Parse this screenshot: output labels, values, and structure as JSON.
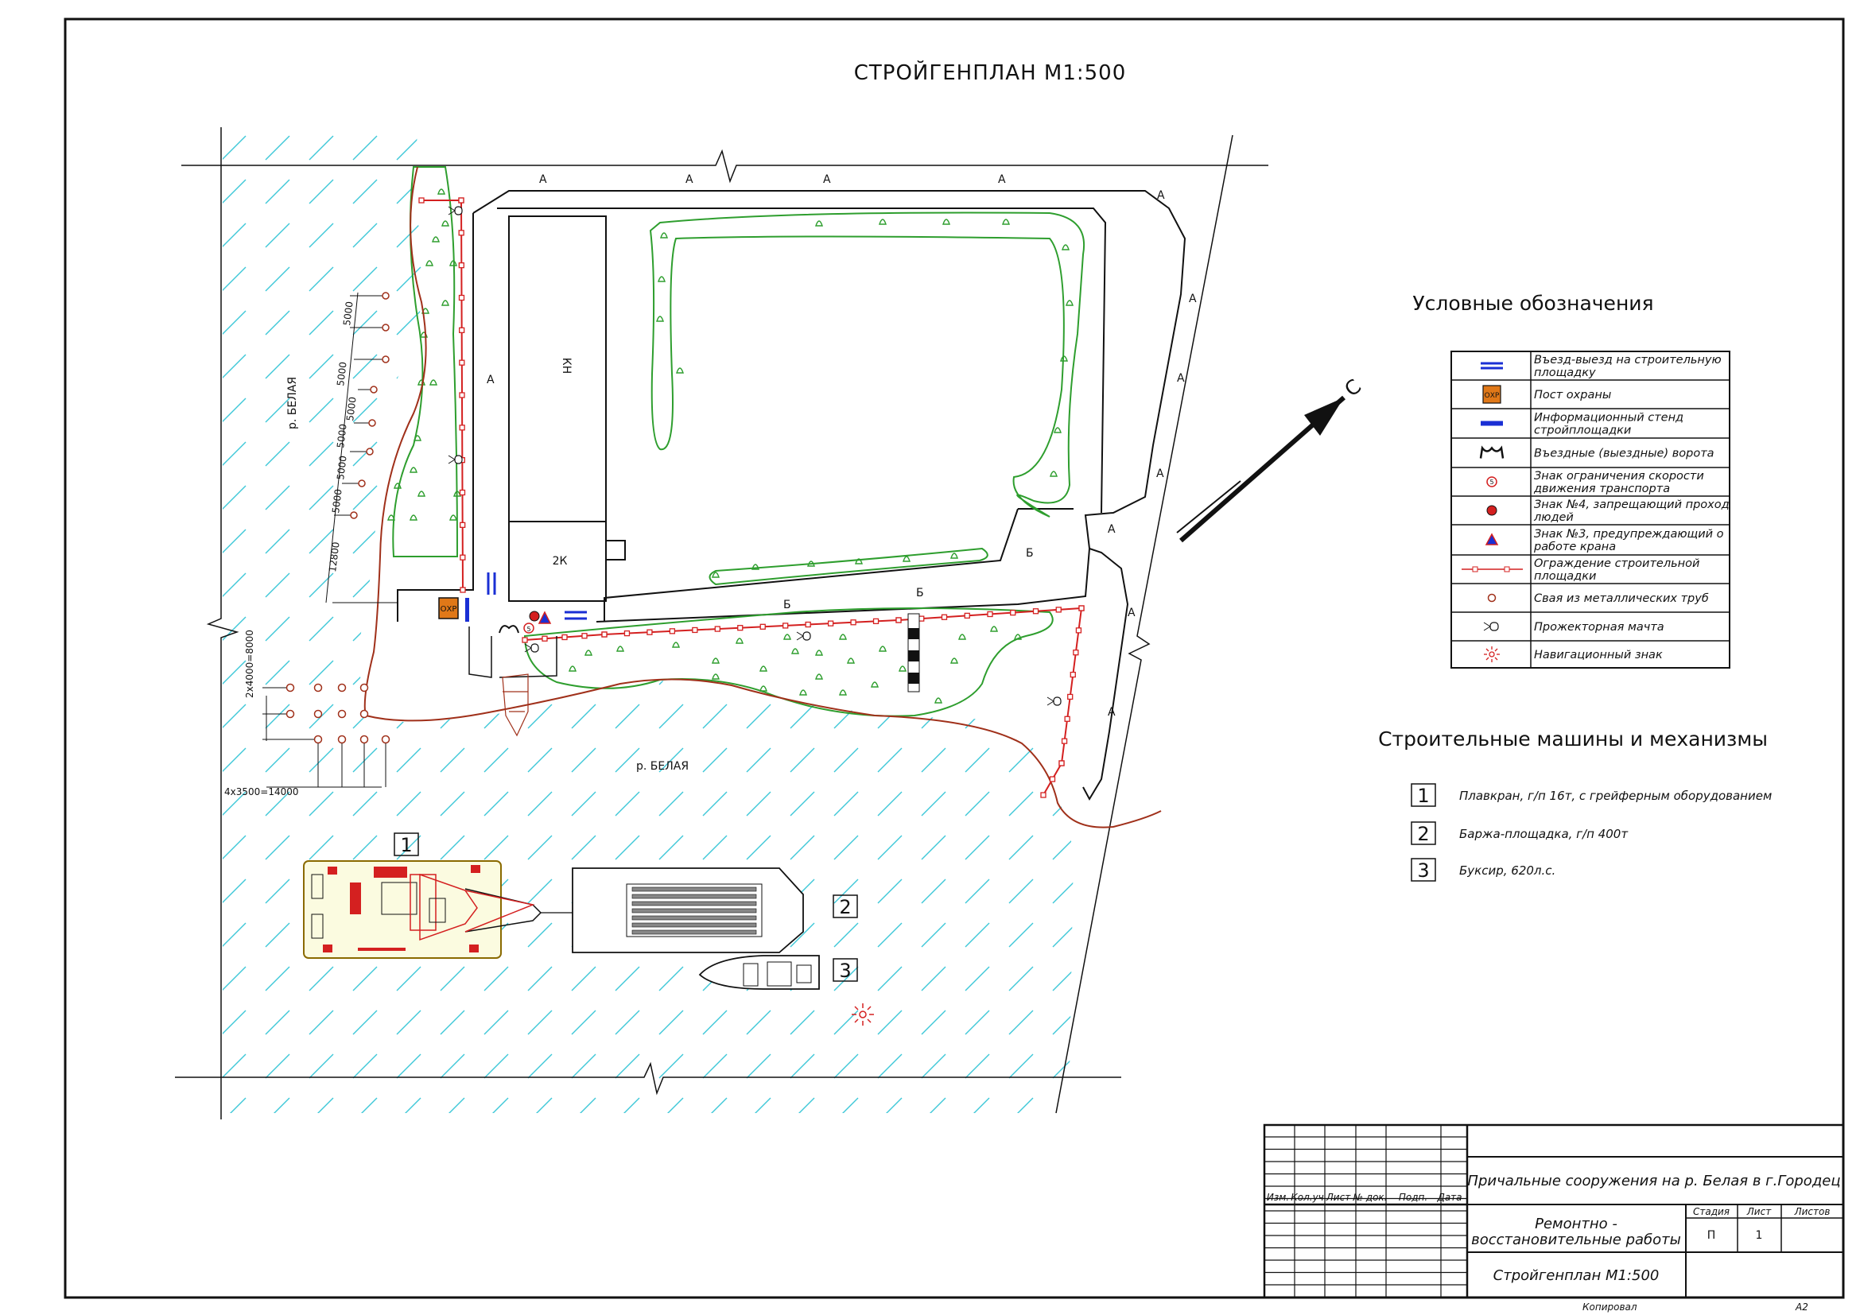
{
  "title": "СТРОЙГЕНПЛАН М1:500",
  "site_labels": {
    "road_a": "А",
    "road_b": "Б",
    "building_kn": "КН",
    "building_2k": "2К",
    "river": "р. БЕЛАЯ",
    "ohr": "ОХР",
    "speed": "5"
  },
  "dimensions": {
    "pile_spacing": "5000",
    "pile_offset": "12800",
    "grid_vertical": "2x4000=8000",
    "grid_horizontal": "4x3500=14000"
  },
  "legend": {
    "title": "Условные обозначения",
    "items": [
      {
        "label1": "Въезд-выезд на строительную",
        "label2": "площадку",
        "icon": "double-arrow-icon"
      },
      {
        "label1": "Пост охраны",
        "label2": "",
        "icon": "guard-post-icon"
      },
      {
        "label1": "Информационный стенд",
        "label2": "стройплощадки",
        "icon": "info-stand-icon"
      },
      {
        "label1": "Въездные (выездные) ворота",
        "label2": "",
        "icon": "gate-icon"
      },
      {
        "label1": "Знак ограничения скорости",
        "label2": "движения транспорта",
        "icon": "speed-sign-icon"
      },
      {
        "label1": "Знак №4, запрещающий проход",
        "label2": "людей",
        "icon": "no-entry-sign-icon"
      },
      {
        "label1": "Знак №3, предупреждающий о",
        "label2": "работе крана",
        "icon": "crane-warning-icon"
      },
      {
        "label1": "Ограждение строительной",
        "label2": "площадки",
        "icon": "fence-icon"
      },
      {
        "label1": "Свая из металлических труб",
        "label2": "",
        "icon": "pile-icon"
      },
      {
        "label1": "Прожекторная мачта",
        "label2": "",
        "icon": "floodlight-mast-icon"
      },
      {
        "label1": "Навигационный знак",
        "label2": "",
        "icon": "navigation-sign-icon"
      }
    ]
  },
  "machines": {
    "title": "Строительные машины и механизмы",
    "items": [
      {
        "num": "1",
        "label": "Плавкран, г/п 16т, с грейферным оборудованием"
      },
      {
        "num": "2",
        "label": "Баржа-площадка, г/п 400т"
      },
      {
        "num": "3",
        "label": "Буксир, 620л.с."
      }
    ]
  },
  "vessel_numbers": [
    "1",
    "2",
    "3"
  ],
  "north": "С",
  "stamp": {
    "col_headers": [
      "Изм.",
      "Кол.уч",
      "Лист",
      "№ док.",
      "Подп.",
      "Дата"
    ],
    "project": "Причальные сооружения на р. Белая в г.Городец",
    "work_line1": "Ремонтно -",
    "work_line2": "восстановительные работы",
    "stage_label": "Стадия",
    "sheet_label": "Лист",
    "sheets_label": "Листов",
    "stage": "П",
    "sheet": "1",
    "sheets": "",
    "drawing": "Стройгенплан М1:500",
    "copied": "Копировал",
    "format": "А2"
  },
  "colors": {
    "fence": "#d42020",
    "green": "#2e9e2e",
    "water": "#3ec8d8",
    "shore": "#a0301a",
    "blue": "#1a2fd4",
    "ohr": "#e07818"
  }
}
